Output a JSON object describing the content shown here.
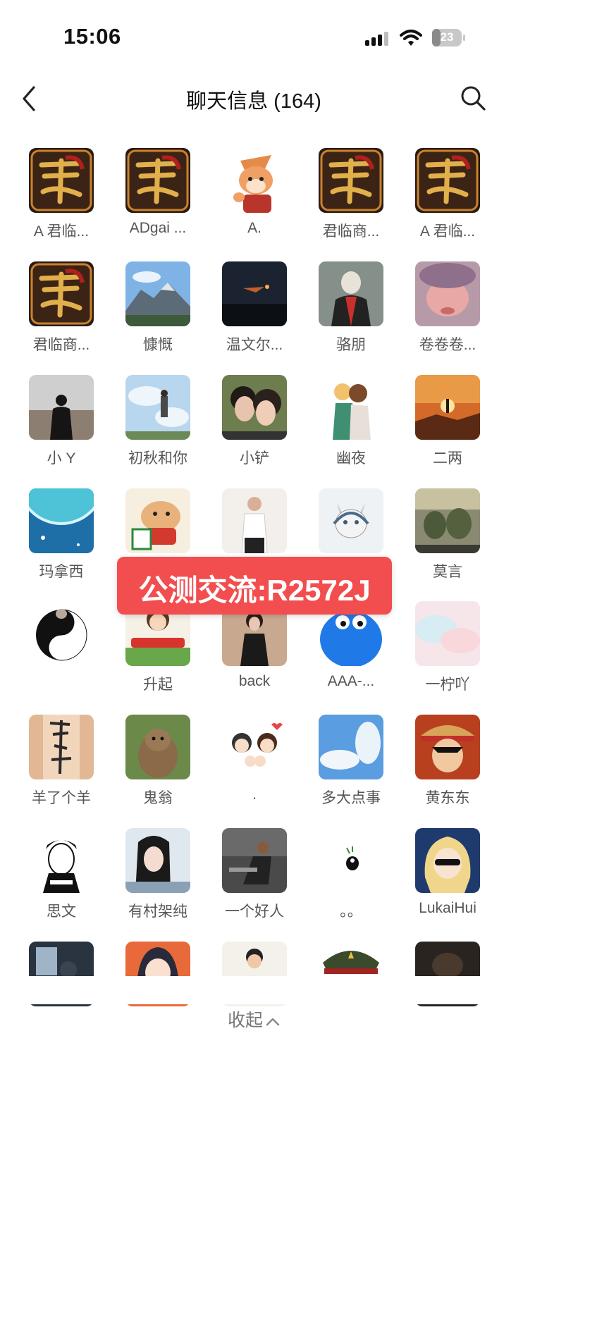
{
  "status_bar": {
    "time": "15:06",
    "battery": "23"
  },
  "header": {
    "title": "聊天信息 (164)"
  },
  "members": [
    {
      "name": "A 君临...",
      "avatar": "game-logo-avatar"
    },
    {
      "name": "ADgai ...",
      "avatar": "game-logo-avatar"
    },
    {
      "name": "A.",
      "avatar": "cartoon-fox-avatar"
    },
    {
      "name": "君临商...",
      "avatar": "game-logo-avatar"
    },
    {
      "name": "A 君临...",
      "avatar": "game-logo-avatar"
    },
    {
      "name": "君临商...",
      "avatar": "game-logo-avatar"
    },
    {
      "name": "慷慨",
      "avatar": "mountain-photo-avatar"
    },
    {
      "name": "温文尔...",
      "avatar": "night-sky-avatar"
    },
    {
      "name": "骆朋",
      "avatar": "masked-hero-avatar"
    },
    {
      "name": "卷卷卷...",
      "avatar": "portrait-photo-avatar"
    },
    {
      "name": "小 Y",
      "avatar": "silhouette-person-avatar"
    },
    {
      "name": "初秋和你",
      "avatar": "anime-sky-avatar"
    },
    {
      "name": "小铲",
      "avatar": "couple-photo-avatar"
    },
    {
      "name": "幽夜",
      "avatar": "anime-couple-avatar"
    },
    {
      "name": "二两",
      "avatar": "sunset-figure-avatar"
    },
    {
      "name": "玛拿西",
      "avatar": "planet-avatar"
    },
    {
      "name": "",
      "avatar": "cartoon-dog-avatar"
    },
    {
      "name": "",
      "avatar": "man-photo-avatar"
    },
    {
      "name": "",
      "avatar": "cat-illustration-avatar"
    },
    {
      "name": "莫言",
      "avatar": "group-photo-avatar"
    },
    {
      "name": "",
      "avatar": "yin-yang-cat-avatar"
    },
    {
      "name": "升起",
      "avatar": "cartoon-girl-avatar"
    },
    {
      "name": "back",
      "avatar": "woman-photo-avatar"
    },
    {
      "name": "AAA-...",
      "avatar": "blue-blob-avatar"
    },
    {
      "name": "一柠吖",
      "avatar": "pastel-avatar"
    },
    {
      "name": "羊了个羊",
      "avatar": "calligraphy-avatar"
    },
    {
      "name": "鬼翁",
      "avatar": "marmot-avatar"
    },
    {
      "name": ".",
      "avatar": "cartoon-family-avatar"
    },
    {
      "name": "多大点事",
      "avatar": "blue-sky-avatar"
    },
    {
      "name": "黄东东",
      "avatar": "anime-pirate-avatar"
    },
    {
      "name": "思文",
      "avatar": "sketch-man-avatar"
    },
    {
      "name": "有村架纯",
      "avatar": "girl-snow-avatar"
    },
    {
      "name": "一个好人",
      "avatar": "gym-photo-avatar"
    },
    {
      "name": "。。",
      "avatar": "tiny-figure-avatar"
    },
    {
      "name": "LukaiHui",
      "avatar": "anime-blonde-avatar"
    },
    {
      "name": "",
      "avatar": "dark-room-avatar"
    },
    {
      "name": "",
      "avatar": "anime-orange-avatar"
    },
    {
      "name": "",
      "avatar": "man-cartoon-avatar"
    },
    {
      "name": "",
      "avatar": "military-cap-avatar"
    },
    {
      "name": "",
      "avatar": "dark-animal-avatar"
    }
  ],
  "footer": {
    "collapse_label": "收起"
  },
  "overlay": {
    "banner_text": "公测交流:R2572J"
  },
  "colors": {
    "banner": "#f24d4f",
    "text_secondary": "#555555"
  }
}
